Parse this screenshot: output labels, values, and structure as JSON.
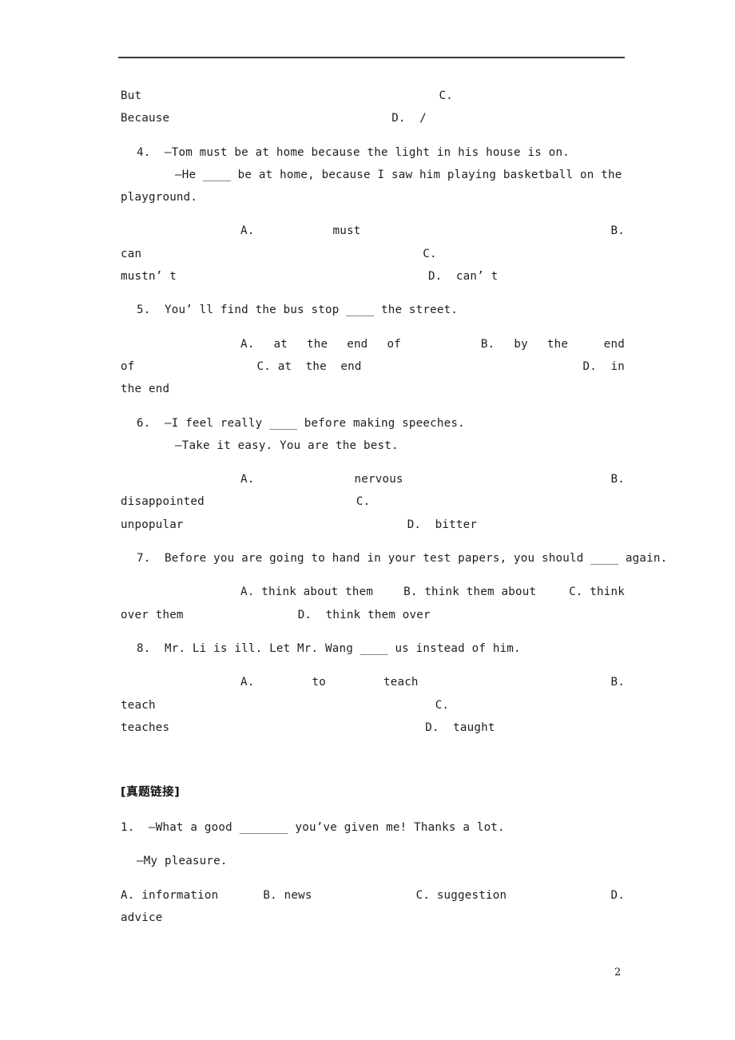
{
  "page": {
    "number": "2",
    "has_top_rule": true
  },
  "carryover_options": {
    "a_label": "But",
    "c_label": "C.",
    "b_label": "Because",
    "d_label": "D.  /"
  },
  "questions": [
    {
      "number": "4.",
      "stem": "4.  —Tom must be at home because the light in his house is on.",
      "stem2": "—He ____ be at home, because I saw him playing basketball on the",
      "stem3": "playground.",
      "options_rows": [
        [
          "A.",
          "must",
          "B."
        ],
        [
          "can",
          "C."
        ],
        [
          "mustn’ t",
          "D.  can’ t"
        ]
      ]
    },
    {
      "number": "5.",
      "stem": "5.  You’ ll find the bus stop ____ the street.",
      "options_rows": [
        [
          "A.",
          "at",
          "the",
          "end",
          "of",
          "B.",
          "by",
          "the",
          "end"
        ],
        [
          "of",
          "C.  at  the  end",
          "D.  in"
        ],
        [
          "the end"
        ]
      ]
    },
    {
      "number": "6.",
      "stem": "6.  —I feel really ____ before making speeches.",
      "stem2": "—Take it easy. You are the best.",
      "options_rows": [
        [
          "A.",
          "nervous",
          "B."
        ],
        [
          "disappointed",
          "C."
        ],
        [
          "unpopular",
          "D.  bitter"
        ]
      ]
    },
    {
      "number": "7.",
      "stem": "7.  Before you are going to hand in your test papers, you should ____ again.",
      "options_rows": [
        [
          "A. think about them",
          "B. think them about",
          "C. think"
        ],
        [
          "over them",
          "D.  think them over"
        ]
      ]
    },
    {
      "number": "8.",
      "stem": "8.  Mr. Li is ill. Let Mr. Wang ____ us instead of him.",
      "options_rows": [
        [
          "A.",
          "to",
          "teach",
          "B."
        ],
        [
          "teach",
          "C."
        ],
        [
          "teaches",
          "D.  taught"
        ]
      ]
    }
  ],
  "section_heading": "[真题链接]",
  "real_exam": [
    {
      "number": "1.",
      "stem": "1.  —What a good _______ you’ve given me! Thanks a lot.",
      "stem2": "—My pleasure.",
      "options_rows": [
        [
          "A. information",
          "B. news",
          "C. suggestion",
          "D."
        ],
        [
          "advice"
        ]
      ]
    }
  ],
  "lines": {
    "l01_but": "But",
    "l01_c": "C.",
    "l02_because": "Because",
    "l02_d": "D.  /",
    "q4_stem": "4.  —Tom must be at home because the light in his house is on.",
    "q4_stem2": "—He ____ be at home, because I saw him playing basketball on the",
    "q4_stem3": "playground.",
    "q4_o1a": "A.",
    "q4_o1b": "must",
    "q4_o1c": "B.",
    "q4_o2a": "can",
    "q4_o2b": "C.",
    "q4_o3a": "mustn’ t",
    "q4_o3b": "D.  can’ t",
    "q5_stem": "5.  You’ ll find the bus stop ____ the street.",
    "q5_o1a": "A.",
    "q5_o1b": "at",
    "q5_o1c": "the",
    "q5_o1d": "end",
    "q5_o1e": "of",
    "q5_o1f": "B.",
    "q5_o1g": "by",
    "q5_o1h": "the",
    "q5_o1i": "end",
    "q5_o2a": "of",
    "q5_o2b": "C. at  the  end",
    "q5_o2c": "D.  in",
    "q5_o3a": "the end",
    "q6_stem": "6.  —I feel really ____ before making speeches.",
    "q6_stem2": "—Take it easy. You are the best.",
    "q6_o1a": "A.",
    "q6_o1b": "nervous",
    "q6_o1c": "B.",
    "q6_o2a": "disappointed",
    "q6_o2b": "C.",
    "q6_o3a": "unpopular",
    "q6_o3b": "D.  bitter",
    "q7_stem": "7.  Before you are going to hand in your test papers, you should ____ again.",
    "q7_o1a": "A. think about them",
    "q7_o1b": "B. think them about",
    "q7_o1c": "C. think",
    "q7_o2a": "over them",
    "q7_o2b": "D.  think them over",
    "q8_stem": "8.  Mr. Li is ill. Let Mr. Wang ____ us instead of him.",
    "q8_o1a": "A.",
    "q8_o1b": "to",
    "q8_o1c": "teach",
    "q8_o1d": "B.",
    "q8_o2a": "teach",
    "q8_o2b": "C.",
    "q8_o3a": "teaches",
    "q8_o3b": "D.  taught",
    "r1_stem": "1.  —What a good _______ you’ve given me! Thanks a lot.",
    "r1_stem2": "—My pleasure.",
    "r1_o1a": "A. information",
    "r1_o1b": "B. news",
    "r1_o1c": "C. suggestion",
    "r1_o1d": "D.",
    "r1_o2a": "advice"
  }
}
